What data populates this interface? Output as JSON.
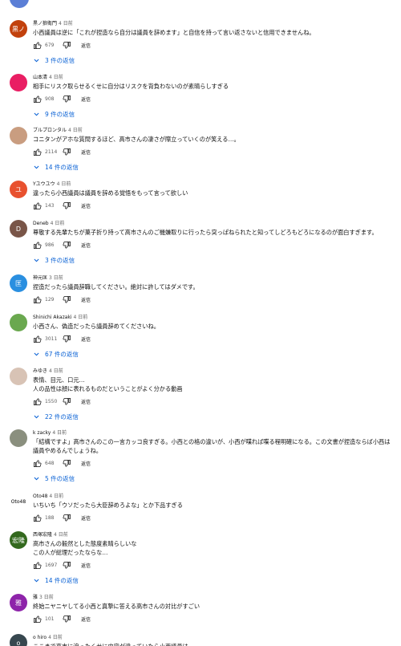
{
  "actions": {
    "reply_label": "返信"
  },
  "colors": {
    "link": "#065fd4",
    "meta": "#606060"
  },
  "comments": [
    {
      "author": "黒ノ狼衛門",
      "time": "4 日前",
      "lines": [
        "小西議員は逆に「これが捏造なら自分は議員を辞めます」と自信を持って言い返さないと信用できませんね。"
      ],
      "likes": "679",
      "replies": "3 件の返信",
      "avatar": {
        "type": "letter",
        "text": "黒ノ",
        "color": "#c2410c"
      }
    },
    {
      "author": "山本清",
      "time": "4 日前",
      "lines": [
        "相手にリスク取らせるくせに自分はリスクを背負わないのが素晴らしすぎる"
      ],
      "likes": "908",
      "replies": "9 件の返信",
      "avatar": {
        "type": "image",
        "icon": "mascot-avatar-icon",
        "color": "#e91e63"
      }
    },
    {
      "author": "ブルプロンタル",
      "time": "4 日前",
      "lines": [
        "コニタンがアホな質問するほど、高市さんの凄さが際立っていくのが笑える…。"
      ],
      "likes": "2114",
      "replies": "14 件の返信",
      "avatar": {
        "type": "image",
        "icon": "person-photo-icon",
        "color": "#c99d80"
      }
    },
    {
      "author": "Yユウユウ",
      "time": "4 日前",
      "lines": [
        "違ったら小西議員は議員を辞める覚悟をもって言って欲しい"
      ],
      "likes": "143",
      "replies": "",
      "avatar": {
        "type": "letter",
        "text": "ユ",
        "color": "#e8512f"
      }
    },
    {
      "author": "Deneb",
      "time": "4 日前",
      "lines": [
        "尊敬する先輩たちが菓子折り持って高市さんのご機嫌取りに行ったら突っぱねられたと知ってしどろもどろになるのが面白すぎます。"
      ],
      "likes": "986",
      "replies": "3 件の返信",
      "avatar": {
        "type": "letter",
        "text": "D",
        "color": "#795548"
      }
    },
    {
      "author": "神元匡",
      "time": "3 日前",
      "lines": [
        "捏造だったら議員辞職してください。絶対に許してはダメです。"
      ],
      "likes": "129",
      "replies": "",
      "avatar": {
        "type": "letter",
        "text": "匡",
        "color": "#2a8fe0"
      }
    },
    {
      "author": "Shinichi Akazaki",
      "time": "4 日前",
      "lines": [
        "小西さん、偽造だったら議員辞めてくださいね。"
      ],
      "likes": "3011",
      "replies": "67 件の返信",
      "avatar": {
        "type": "image",
        "icon": "person-photo-icon",
        "color": "#6aa84f"
      }
    },
    {
      "author": "みゆき",
      "time": "4 日前",
      "lines": [
        "表情、目元、口元…",
        "人の品性は顔に表れるものだということがよく分かる動画"
      ],
      "likes": "1550",
      "replies": "22 件の返信",
      "avatar": {
        "type": "image",
        "icon": "person-photo-icon",
        "color": "#d8c3b5"
      }
    },
    {
      "author": "k zacky",
      "time": "4 日前",
      "lines": [
        "「結構ですよ」高市さんのこの一言カッコ良すぎる。小西との格の違いが、小西が喋れば喋る程明確になる。この文書が捏造ならば小西は議員やめるんでしょうね。"
      ],
      "likes": "648",
      "replies": "5 件の返信",
      "avatar": {
        "type": "image",
        "icon": "scenery-photo-icon",
        "color": "#8a8f7e"
      }
    },
    {
      "author": "Oto48",
      "time": "4 日前",
      "lines": [
        "いちいち「ウソだったら大臣辞めろよな」とか下品すぎる"
      ],
      "likes": "188",
      "replies": "",
      "avatar": {
        "type": "text",
        "text": "Oto48",
        "color": "#ffffff"
      }
    },
    {
      "author": "西塚宏隆",
      "time": "4 日前",
      "lines": [
        "高市さんの毅然とした態度素晴らしいな",
        "この人が総理だったならな…"
      ],
      "likes": "1697",
      "replies": "14 件の返信",
      "avatar": {
        "type": "letter",
        "text": "宏隆",
        "color": "#33691e"
      }
    },
    {
      "author": "雅",
      "time": "3 日前",
      "lines": [
        "終始ニヤニヤしてる小西と真摯に答える高市さんの対比がすごい"
      ],
      "likes": "101",
      "replies": "",
      "avatar": {
        "type": "letter",
        "text": "雅",
        "color": "#8e24aa"
      }
    },
    {
      "author": "o hiro",
      "time": "4 日前",
      "lines": [
        "ここまで高市に迫ったくせに内容が違っていたら小西議員は…"
      ],
      "likes": "",
      "replies": "",
      "avatar": {
        "type": "letter",
        "text": "o",
        "color": "#37474f"
      }
    }
  ]
}
